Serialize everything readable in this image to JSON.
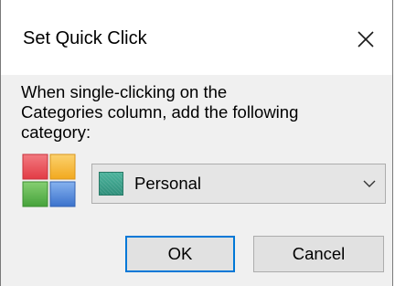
{
  "dialog": {
    "title": "Set Quick Click",
    "close_icon": "close-icon"
  },
  "prompt": {
    "lines": [
      "When single-clicking on the",
      "Categories column, add the following",
      "category:"
    ]
  },
  "category_icon": "color-categories-icon",
  "category_select": {
    "selected_value": "Personal",
    "swatch_color": "#3aa08a",
    "dropdown_icon": "chevron-down-icon"
  },
  "buttons": {
    "ok_label": "OK",
    "cancel_label": "Cancel"
  },
  "colors": {
    "accent": "#0078d7",
    "category_red": "#e8474f",
    "category_orange": "#f5b83d",
    "category_green": "#5bb450",
    "category_blue": "#4d86d8"
  }
}
